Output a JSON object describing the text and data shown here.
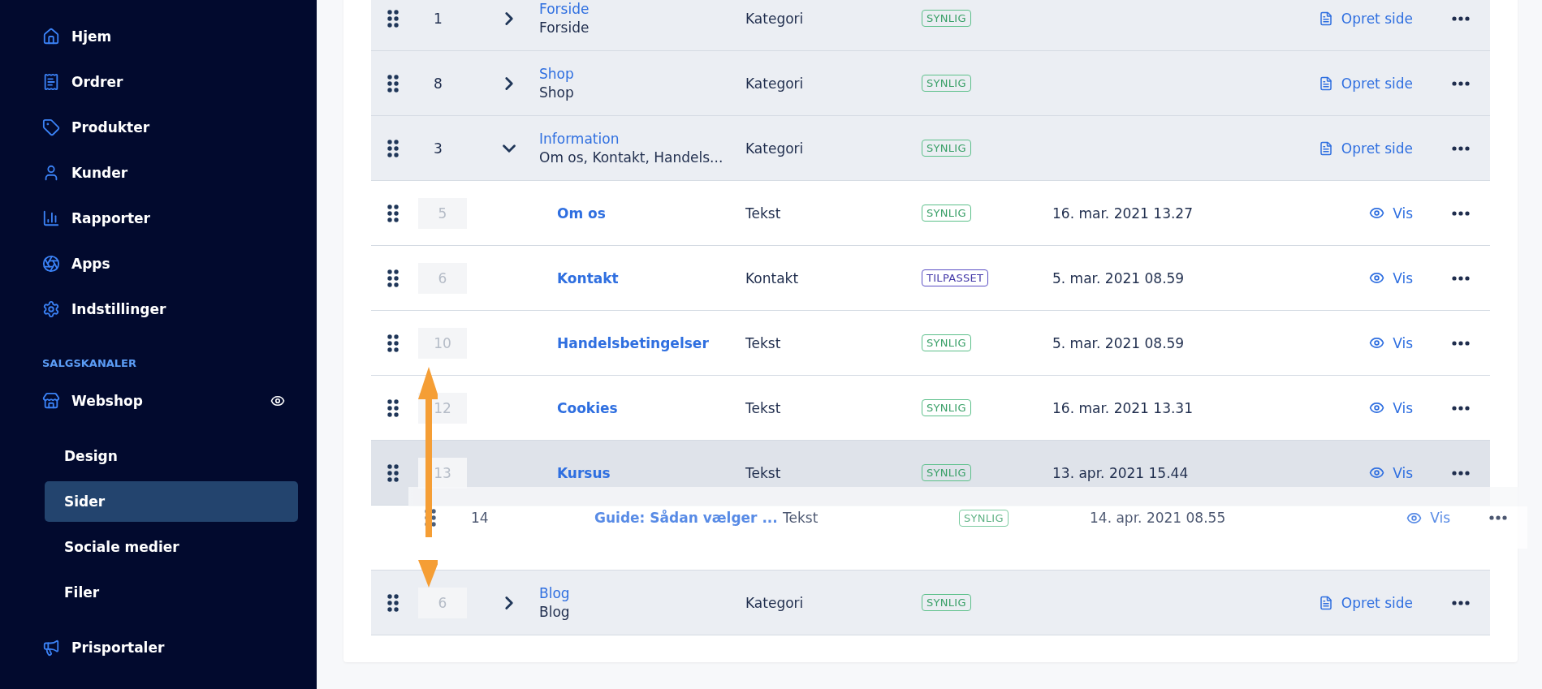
{
  "sidebar": {
    "items": [
      {
        "label": "Hjem",
        "selected": false
      },
      {
        "label": "Ordrer",
        "selected": false
      },
      {
        "label": "Produkter",
        "selected": false
      },
      {
        "label": "Kunder",
        "selected": false
      },
      {
        "label": "Rapporter",
        "selected": false
      },
      {
        "label": "Apps",
        "selected": false
      },
      {
        "label": "Indstillinger",
        "selected": false
      }
    ],
    "section_heading": "SALGSKANALER",
    "channels": [
      {
        "label": "Webshop",
        "children": [
          {
            "label": "Design",
            "selected": false
          },
          {
            "label": "Sider",
            "selected": true
          },
          {
            "label": "Sociale medier",
            "selected": false
          },
          {
            "label": "Filer",
            "selected": false
          }
        ]
      }
    ],
    "bottom_items": [
      {
        "label": "Prisportaler",
        "selected": false
      }
    ]
  },
  "table": {
    "rows": [
      {
        "kind": "category",
        "number": "1",
        "number_faded": false,
        "expanded": false,
        "title": "Forside",
        "subtitle": "Forside",
        "type": "Kategori",
        "status": {
          "label": "SYNLIG",
          "kind": "visible"
        },
        "action": {
          "label": "Opret side",
          "kind": "create"
        },
        "highlighted": false
      },
      {
        "kind": "category",
        "number": "8",
        "number_faded": false,
        "expanded": false,
        "title": "Shop",
        "subtitle": "Shop",
        "type": "Kategori",
        "status": {
          "label": "SYNLIG",
          "kind": "visible"
        },
        "action": {
          "label": "Opret side",
          "kind": "create"
        },
        "highlighted": false
      },
      {
        "kind": "category",
        "number": "3",
        "number_faded": false,
        "expanded": true,
        "title": "Information",
        "subtitle": "Om os, Kontakt, Handels...",
        "type": "Kategori",
        "status": {
          "label": "SYNLIG",
          "kind": "visible"
        },
        "action": {
          "label": "Opret side",
          "kind": "create"
        },
        "highlighted": false
      },
      {
        "kind": "page",
        "number": "5",
        "number_faded": true,
        "title": "Om os",
        "type": "Tekst",
        "status": {
          "label": "SYNLIG",
          "kind": "visible"
        },
        "date": "16. mar. 2021 13.27",
        "action": {
          "label": "Vis",
          "kind": "view"
        },
        "highlighted": false
      },
      {
        "kind": "page",
        "number": "6",
        "number_faded": true,
        "title": "Kontakt",
        "type": "Kontakt",
        "status": {
          "label": "TILPASSET",
          "kind": "custom"
        },
        "date": "5. mar. 2021 08.59",
        "action": {
          "label": "Vis",
          "kind": "view"
        },
        "highlighted": false
      },
      {
        "kind": "page",
        "number": "10",
        "number_faded": true,
        "title": "Handelsbetingelser",
        "type": "Tekst",
        "status": {
          "label": "SYNLIG",
          "kind": "visible"
        },
        "date": "5. mar. 2021 08.59",
        "action": {
          "label": "Vis",
          "kind": "view"
        },
        "highlighted": false
      },
      {
        "kind": "page",
        "number": "12",
        "number_faded": true,
        "title": "Cookies",
        "type": "Tekst",
        "status": {
          "label": "SYNLIG",
          "kind": "visible"
        },
        "date": "16. mar. 2021 13.31",
        "action": {
          "label": "Vis",
          "kind": "view"
        },
        "highlighted": false
      },
      {
        "kind": "page",
        "number": "13",
        "number_faded": true,
        "title": "Kursus",
        "type": "Tekst",
        "status": {
          "label": "SYNLIG",
          "kind": "visible"
        },
        "date": "13. apr. 2021 15.44",
        "action": {
          "label": "Vis",
          "kind": "view"
        },
        "highlighted": true
      },
      {
        "kind": "placeholder"
      },
      {
        "kind": "category",
        "number": "6",
        "number_faded": true,
        "expanded": false,
        "title": "Blog",
        "subtitle": "Blog",
        "type": "Kategori",
        "status": {
          "label": "SYNLIG",
          "kind": "visible"
        },
        "action": {
          "label": "Opret side",
          "kind": "create"
        },
        "highlighted": false
      }
    ],
    "dragged_row": {
      "number": "14",
      "number_faded": false,
      "title": "Guide: Sådan vælger ...",
      "type": "Tekst",
      "status": {
        "label": "SYNLIG",
        "kind": "visible"
      },
      "date": "14. apr. 2021 08.55",
      "action": {
        "label": "Vis",
        "kind": "view"
      }
    }
  }
}
